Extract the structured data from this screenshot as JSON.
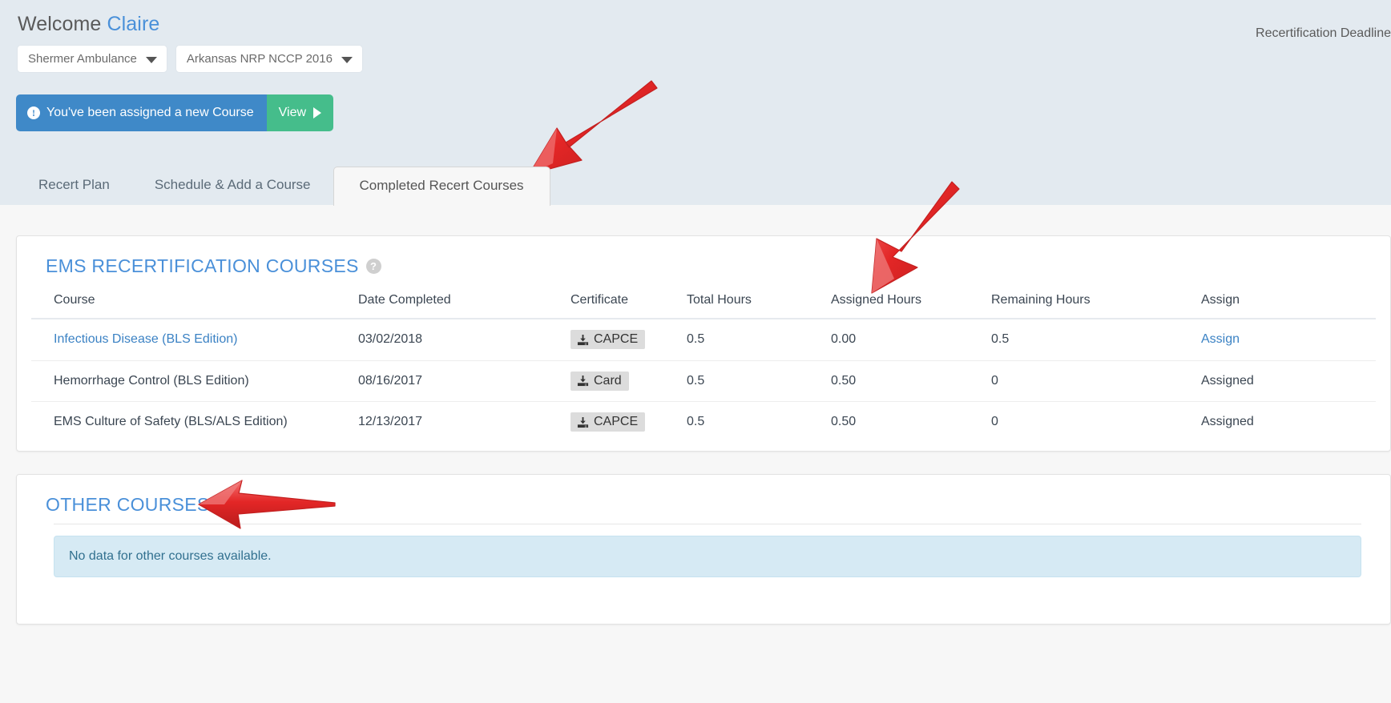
{
  "header": {
    "welcome_prefix": "Welcome",
    "user_name": "Claire",
    "deadline_label": "Recertification Deadline"
  },
  "selectors": [
    {
      "name": "organization",
      "value": "Shermer Ambulance"
    },
    {
      "name": "program",
      "value": "Arkansas NRP NCCP 2016"
    }
  ],
  "notification": {
    "message": "You've been assigned a new Course",
    "action_label": "View",
    "info_glyph": "!"
  },
  "tabs": [
    {
      "label": "Recert Plan",
      "active": false
    },
    {
      "label": "Schedule & Add a Course",
      "active": false
    },
    {
      "label": "Completed Recert Courses",
      "active": true
    }
  ],
  "ems_section": {
    "title": "EMS RECERTIFICATION COURSES",
    "help_glyph": "?",
    "columns": [
      "Course",
      "Date Completed",
      "Certificate",
      "Total Hours",
      "Assigned Hours",
      "Remaining Hours",
      "Assign"
    ],
    "rows": [
      {
        "course": "Infectious Disease (BLS Edition)",
        "course_is_link": true,
        "date_completed": "03/02/2018",
        "certificate": "CAPCE",
        "total_hours": "0.5",
        "assigned_hours": "0.00",
        "remaining_hours": "0.5",
        "assign": "Assign",
        "assign_is_link": true
      },
      {
        "course": "Hemorrhage Control (BLS Edition)",
        "course_is_link": false,
        "date_completed": "08/16/2017",
        "certificate": "Card",
        "total_hours": "0.5",
        "assigned_hours": "0.50",
        "remaining_hours": "0",
        "assign": "Assigned",
        "assign_is_link": false
      },
      {
        "course": "EMS Culture of Safety (BLS/ALS Edition)",
        "course_is_link": false,
        "date_completed": "12/13/2017",
        "certificate": "CAPCE",
        "total_hours": "0.5",
        "assigned_hours": "0.50",
        "remaining_hours": "0",
        "assign": "Assigned",
        "assign_is_link": false
      }
    ]
  },
  "other_section": {
    "title": "OTHER COURSES",
    "help_glyph": "?",
    "empty_message": "No data for other courses available."
  },
  "colors": {
    "page_background": "#e3eaf0",
    "content_background": "#f7f7f7",
    "link_blue": "#3b82c4",
    "heading_blue": "#4a90d9",
    "notify_blue": "#3f89c8",
    "notify_green": "#45bd8b",
    "badge_gray": "#dcdcdc",
    "alert_info_bg": "#d6eaf4",
    "annotation_red": "#e02b2b"
  },
  "annotations": [
    {
      "name": "arrow-to-completed-tab",
      "points_to": "Completed Recert Courses"
    },
    {
      "name": "arrow-to-assigned-hours",
      "points_to": "Assigned Hours"
    },
    {
      "name": "arrow-to-other-courses",
      "points_to": "OTHER COURSES"
    }
  ]
}
